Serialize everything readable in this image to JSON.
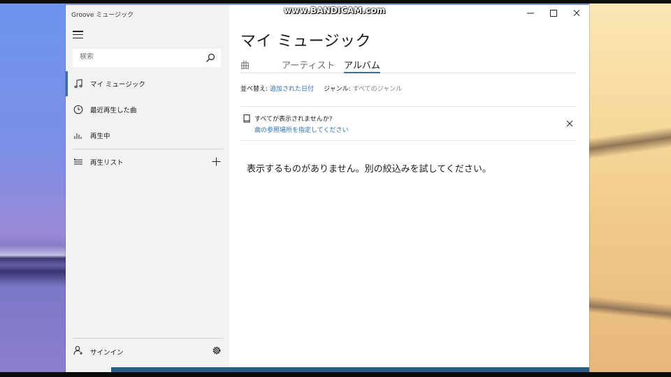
{
  "watermark": "www.BANDICAM.com",
  "app": {
    "title": "Groove ミュージック"
  },
  "search": {
    "placeholder": "検索"
  },
  "nav": {
    "items": [
      {
        "label": "マイ ミュージック",
        "icon": "music-note-icon",
        "selected": true
      },
      {
        "label": "最近再生した曲",
        "icon": "clock-icon",
        "selected": false
      },
      {
        "label": "再生中",
        "icon": "equalizer-icon",
        "selected": false
      },
      {
        "label": "再生リスト",
        "icon": "playlist-icon",
        "selected": false
      }
    ],
    "signin_label": "サインイン"
  },
  "main": {
    "page_title": "マイ ミュージック",
    "tabs": [
      {
        "label": "曲",
        "active": false
      },
      {
        "label": "アーティスト",
        "active": false
      },
      {
        "label": "アルバム",
        "active": true
      }
    ],
    "sort_label": "並べ替え:",
    "sort_value": "追加された日付",
    "genre_label": "ジャンル:",
    "genre_value": "すべてのジャンル",
    "notice_title": "すべてが表示されませんか?",
    "notice_link": "曲の参照場所を指定してください",
    "empty_message": "表示するものがありません。別の絞込みを試してください。"
  },
  "colors": {
    "accent": "#3b6ea5",
    "link": "#2c6fb0",
    "nav_bg": "#f2f2f2"
  }
}
